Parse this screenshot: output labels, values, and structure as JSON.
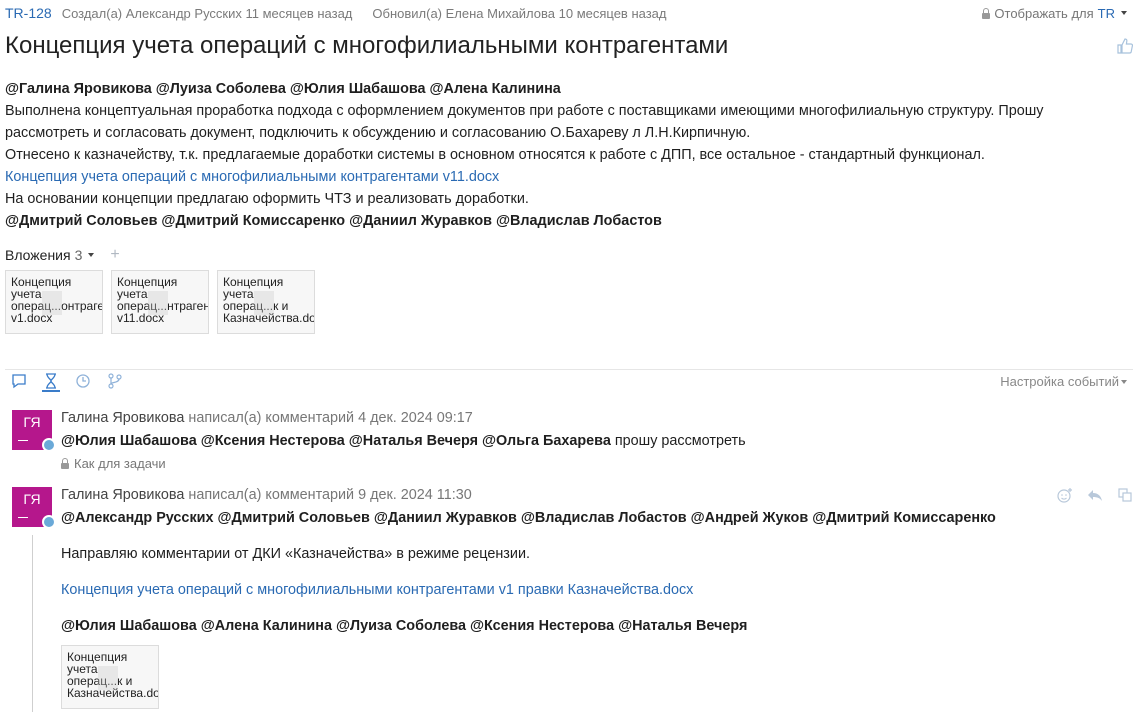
{
  "header": {
    "issue_key": "TR-128",
    "created": "Создал(а) Александр Русских 11 месяцев назад",
    "updated": "Обновил(а) Елена Михайлова 10 месяцев назад",
    "visibility_label": "Отображать для",
    "visibility_value": "TR"
  },
  "title": "Концепция учета операций с многофилиальными контрагентами",
  "description": {
    "line1": "@Галина Яровикова @Луиза Соболева @Юлия Шабашова @Алена Калинина",
    "line2": "Выполнена концептуальная проработка подхода с оформлением документов при работе с поставщиками имеющими многофилиальную структуру. Прошу рассмотреть и согласовать документ, подключить к обсуждению и согласованию О.Бахареву л Л.Н.Кирпичную.",
    "line3": "Отнесено к казначейству, т.к. предлагаемые доработки системы в основном относятся к работе с ДПП, все остальное - стандартный функционал.",
    "link": "Концепция учета операций с многофилиальными контрагентами v11.docx",
    "line4": "На основании концепции предлагаю оформить ЧТЗ и реализовать доработки.",
    "line5": "@Дмитрий Соловьев @Дмитрий Комиссаренко @Даниил Журавков @Владислав Лобастов"
  },
  "attachments": {
    "label": "Вложения",
    "count": "3",
    "files": [
      "Концепция учета операц...онтрагентами v1.docx",
      "Концепция учета операц...нтрагентами v11.docx",
      "Концепция учета операц...к и Казначейства.docx"
    ]
  },
  "activity": {
    "events_settings": "Настройка событий"
  },
  "comments": [
    {
      "initials": "ГЯ",
      "author": "Галина Яровикова",
      "action": "написал(а) комментарий",
      "date": "4 дек. 2024 09:17",
      "mentions": "@Юлия Шабашова @Ксения Нестерова @Наталья Вечеря @Ольга Бахарева",
      "text": "прошу рассмотреть",
      "permission": "Как для задачи"
    },
    {
      "initials": "ГЯ",
      "author": "Галина Яровикова",
      "action": "написал(а) комментарий",
      "date": "9 дек. 2024 11:30",
      "mentions": "@Александр Русских @Дмитрий Соловьев @Даниил Журавков @Владислав Лобастов @Андрей Жуков @Дмитрий Комиссаренко",
      "text": "Направляю комментарии от ДКИ «Казначейства» в режиме рецензии.",
      "link": "Концепция учета операций с многофилиальными контрагентами v1 правки Казначейства.docx",
      "mentions2": "@Юлия Шабашова @Алена Калинина @Луиза Соболева @Ксения Нестерова @Наталья Вечеря",
      "file": "Концепция учета операц...к и Казначейства.docx"
    }
  ],
  "colors": {
    "accent": "#2a6ab3",
    "avatar": "#b5178c"
  }
}
